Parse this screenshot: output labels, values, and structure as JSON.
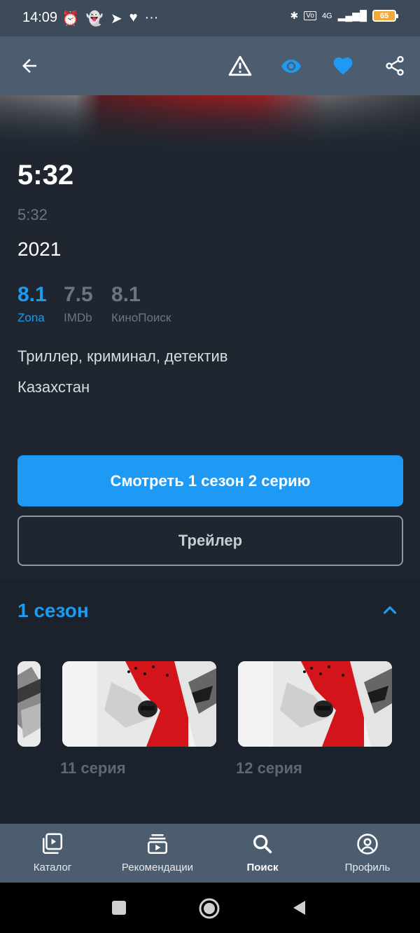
{
  "status_bar": {
    "time": "14:09",
    "battery": "65",
    "network": "4G"
  },
  "toolbar": {
    "back_icon": "arrow-left-icon",
    "icons": [
      "warning-icon",
      "eye-icon",
      "heart-icon",
      "share-icon"
    ],
    "accent": "#1e9af5"
  },
  "movie": {
    "title": "5:32",
    "original_title": "5:32",
    "year": "2021",
    "ratings": [
      {
        "value": "8.1",
        "source": "Zona",
        "active": true
      },
      {
        "value": "7.5",
        "source": "IMDb",
        "active": false
      },
      {
        "value": "8.1",
        "source": "КиноПоиск",
        "active": false
      }
    ],
    "genres": "Триллер, криминал, детектив",
    "country": "Казахстан"
  },
  "actions": {
    "watch_label": "Смотреть 1 сезон 2 серию",
    "trailer_label": "Трейлер"
  },
  "season": {
    "title": "1 сезон",
    "episodes": [
      {
        "label": ""
      },
      {
        "label": "11 серия"
      },
      {
        "label": "12 серия"
      }
    ]
  },
  "bottom_nav": {
    "items": [
      {
        "label": "Каталог",
        "icon": "catalog-icon"
      },
      {
        "label": "Рекомендации",
        "icon": "recommendations-icon"
      },
      {
        "label": "Поиск",
        "icon": "search-icon",
        "active": true
      },
      {
        "label": "Профиль",
        "icon": "profile-icon"
      }
    ]
  }
}
